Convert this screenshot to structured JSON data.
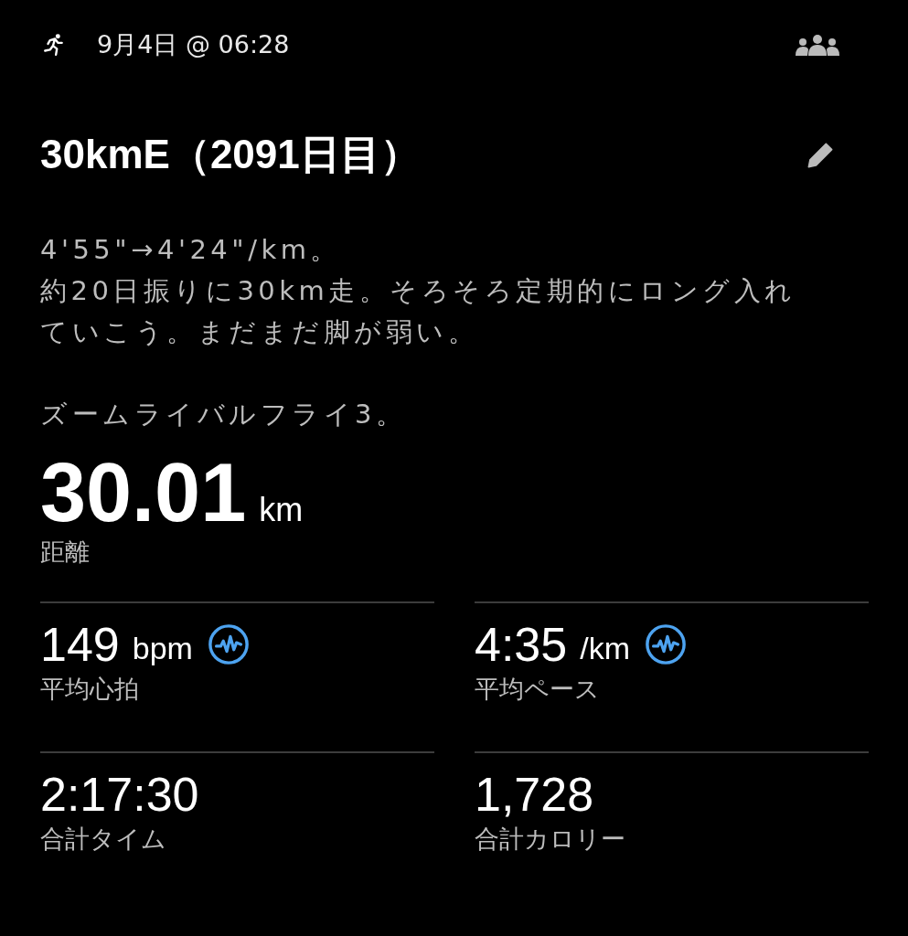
{
  "header": {
    "date": "9月4日 @ 06:28"
  },
  "title": "30kmE（2091日目）",
  "notes": [
    "4'55\"→4'24\"/km。",
    "約20日振りに30km走。そろそろ定期的にロング入れていこう。まだまだ脚が弱い。",
    "ズームライバルフライ3。"
  ],
  "distance": {
    "value": "30.01",
    "unit": "km",
    "label": "距離"
  },
  "stats": [
    {
      "value": "149",
      "unit": "bpm",
      "label": "平均心拍",
      "chart_badge": true
    },
    {
      "value": "4:35",
      "unit": "/km",
      "label": "平均ペース",
      "chart_badge": true
    },
    {
      "value": "2:17:30",
      "label": "合計タイム",
      "chart_badge": false
    },
    {
      "value": "1,728",
      "label": "合計カロリー",
      "chart_badge": false
    }
  ]
}
